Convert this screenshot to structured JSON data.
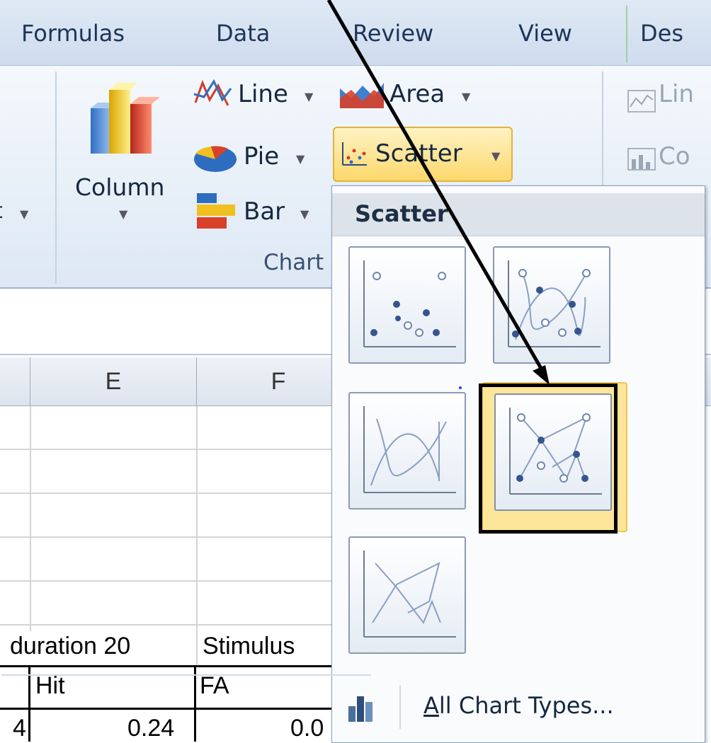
{
  "tabs": [
    "Formulas",
    "Data",
    "Review",
    "View",
    "Des"
  ],
  "ribbon": {
    "left_fragment": "t",
    "column": {
      "label": "Column"
    },
    "line": {
      "label": "Line"
    },
    "area": {
      "label": "Area"
    },
    "pie": {
      "label": "Pie"
    },
    "scatter": {
      "label": "Scatter"
    },
    "bar": {
      "label": "Bar"
    },
    "group_label": "Chart",
    "sparklines": [
      {
        "label": "Lin"
      },
      {
        "label": "Co"
      }
    ]
  },
  "grid": {
    "columns": [
      "E",
      "F"
    ],
    "row_labels": [
      "duration 20",
      "Stimulus"
    ],
    "header_row": [
      "Hit",
      "FA"
    ],
    "data_row": [
      "4",
      "0.24",
      "0.0"
    ]
  },
  "dropdown": {
    "title": "Scatter",
    "thumbnails": [
      {
        "name": "scatter-markers-only",
        "selected": false
      },
      {
        "name": "scatter-smooth-lines-markers",
        "selected": false
      },
      {
        "name": "scatter-smooth-lines",
        "selected": false
      },
      {
        "name": "scatter-straight-lines-markers",
        "selected": true
      },
      {
        "name": "scatter-straight-lines",
        "selected": false
      }
    ],
    "footer": {
      "label": "All Chart Types...",
      "underline_char": "A",
      "rest": "ll Chart Types..."
    }
  },
  "colors": {
    "highlight": "#fde69a",
    "highlight_border": "#f1c24f",
    "tab_sep": "#9cd19a"
  },
  "icons": [
    "column-chart-icon",
    "line-chart-icon",
    "area-chart-icon",
    "pie-chart-icon",
    "scatter-chart-icon",
    "bar-chart-icon",
    "sparkline-line-icon",
    "sparkline-column-icon",
    "all-chart-types-icon"
  ]
}
